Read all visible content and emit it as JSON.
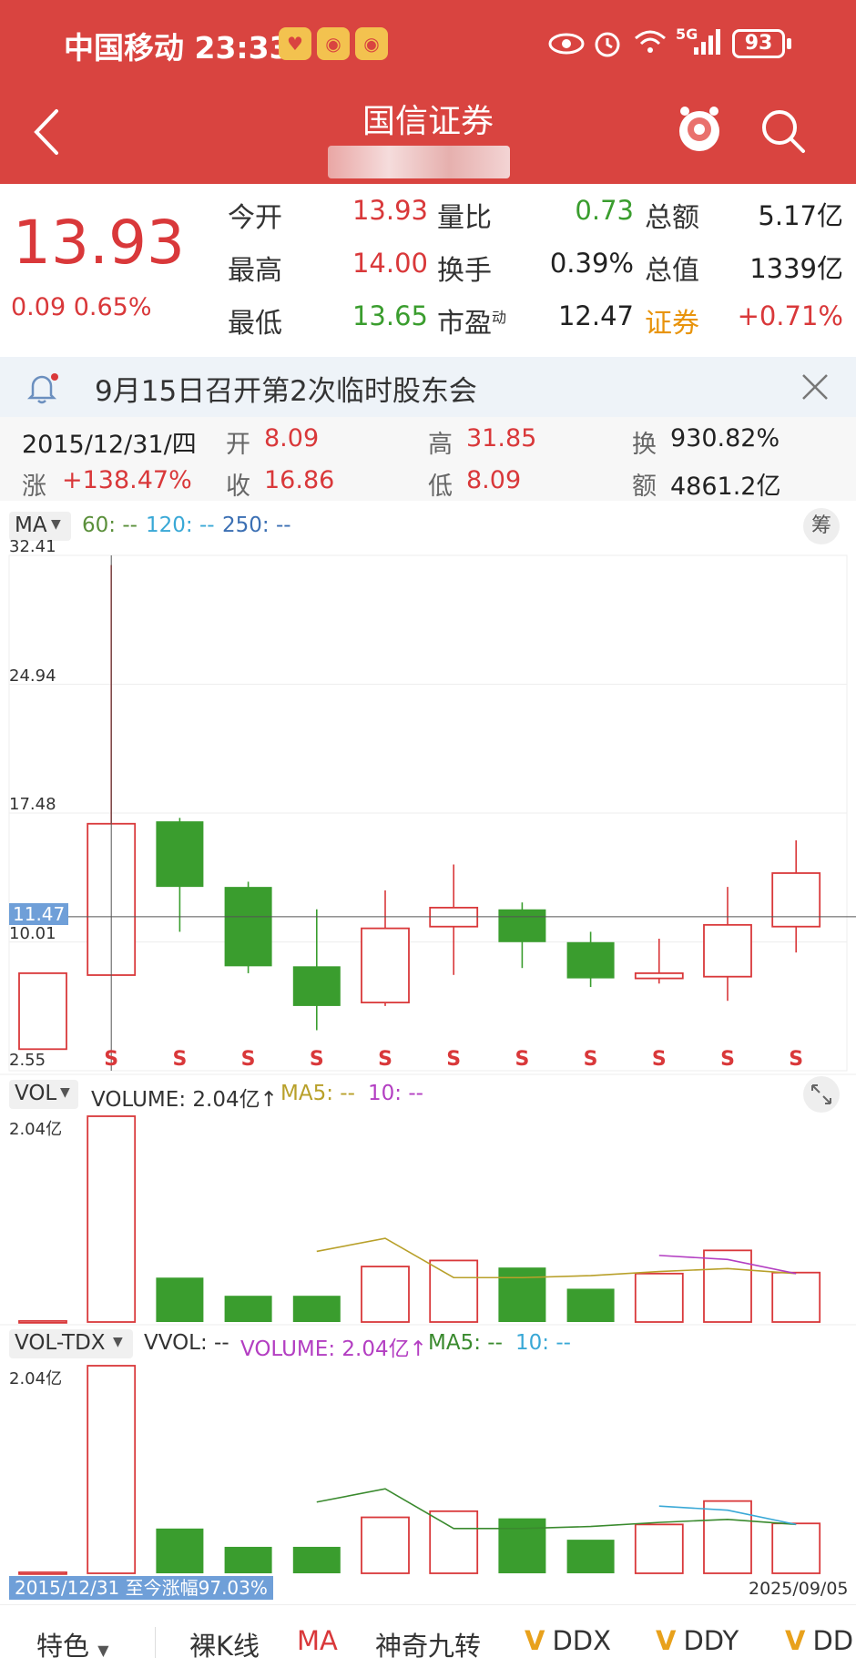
{
  "status_bar": {
    "carrier_time": "中国移动 23:33",
    "network": "5G",
    "battery": "93"
  },
  "nav": {
    "title": "国信证券",
    "icons": [
      "back-icon",
      "mascot-icon",
      "search-icon"
    ]
  },
  "quote": {
    "price": "13.93",
    "change": "0.09  0.65%",
    "rows": [
      {
        "l1": "今开",
        "v1": "13.93",
        "c1": "red",
        "l2": "量比",
        "v2": "0.73",
        "c2": "green",
        "l3": "总额",
        "v3": "5.17亿",
        "c3": "dark"
      },
      {
        "l1": "最高",
        "v1": "14.00",
        "c1": "red",
        "l2": "换手",
        "v2": "0.39%",
        "c2": "dark",
        "l3": "总值",
        "v3": "1339亿",
        "c3": "dark"
      },
      {
        "l1": "最低",
        "v1": "13.65",
        "c1": "green",
        "l2": "市盈",
        "l2sup": "动",
        "v2": "12.47",
        "c2": "dark",
        "l3": "证券",
        "v3": "+0.71%",
        "c3": "red"
      }
    ]
  },
  "notice": {
    "text": "9月15日召开第2次临时股东会"
  },
  "kline_info": {
    "date": "2015/12/31/四",
    "open_label": "开",
    "open": "8.09",
    "high_label": "高",
    "high": "31.85",
    "turn_label": "换",
    "turn": "930.82%",
    "chg_label": "涨",
    "chg": "+138.47%",
    "close_label": "收",
    "close": "16.86",
    "low_label": "低",
    "low": "8.09",
    "amt_label": "额",
    "amt": "4861.2亿"
  },
  "panels": {
    "ma_selector": "MA",
    "ma_values": [
      "60: --",
      "120: --",
      "250: --"
    ],
    "chip_button": "筹",
    "vol_selector": "VOL",
    "vol_text": "VOLUME: 2.04亿↑",
    "vol_ma5": "MA5: --",
    "vol_ma10": "10: --",
    "voltdx_selector": "VOL-TDX",
    "voltdx_vvol": "VVOL: --",
    "voltdx_volume": "VOLUME: 2.04亿↑",
    "voltdx_ma5": "MA5: --",
    "voltdx_ma10": "10: --",
    "crosshair_price": "11.47",
    "range_text": "2015/12/31 至今涨幅97.03%",
    "end_date": "2025/09/05"
  },
  "chart_data": {
    "type": "candlestick",
    "period": "yearly",
    "y_axis": {
      "min": 2.55,
      "max": 32.41,
      "ticks": [
        "32.41",
        "24.94",
        "17.48",
        "10.01",
        "2.55"
      ]
    },
    "candles": [
      {
        "open": 3.8,
        "close": 8.2,
        "high": 8.2,
        "low": 3.8,
        "up": true
      },
      {
        "open": 8.09,
        "close": 16.86,
        "high": 31.85,
        "low": 8.09,
        "up": true
      },
      {
        "open": 17.0,
        "close": 13.2,
        "high": 17.2,
        "low": 10.6,
        "up": false
      },
      {
        "open": 13.2,
        "close": 8.6,
        "high": 13.5,
        "low": 8.2,
        "up": false
      },
      {
        "open": 8.6,
        "close": 6.3,
        "high": 11.9,
        "low": 4.9,
        "up": false
      },
      {
        "open": 6.5,
        "close": 10.8,
        "high": 13.0,
        "low": 6.3,
        "up": true
      },
      {
        "open": 10.9,
        "close": 12.0,
        "high": 14.5,
        "low": 8.1,
        "up": true
      },
      {
        "open": 11.9,
        "close": 10.0,
        "high": 12.3,
        "low": 8.5,
        "up": false
      },
      {
        "open": 10.0,
        "close": 7.9,
        "high": 10.6,
        "low": 7.4,
        "up": false
      },
      {
        "open": 7.9,
        "close": 8.2,
        "high": 10.2,
        "low": 7.6,
        "up": true
      },
      {
        "open": 8.0,
        "close": 11.0,
        "high": 13.2,
        "low": 6.6,
        "up": true
      },
      {
        "open": 10.9,
        "close": 14.0,
        "high": 15.9,
        "low": 9.4,
        "up": true
      }
    ],
    "signal_marks": [
      "S",
      "S",
      "S",
      "S",
      "S",
      "S",
      "S",
      "S",
      "S",
      "S",
      "S"
    ],
    "volume": {
      "max_label": "2.04亿",
      "values": [
        0.01,
        2.04,
        0.44,
        0.26,
        0.26,
        0.55,
        0.61,
        0.54,
        0.33,
        0.48,
        0.71,
        0.49
      ],
      "ma5": [
        null,
        null,
        null,
        null,
        0.7,
        0.83,
        0.44,
        0.44,
        0.46,
        0.5,
        0.53,
        0.48
      ],
      "ma10": [
        null,
        null,
        null,
        null,
        null,
        null,
        null,
        null,
        null,
        0.66,
        0.62,
        0.48
      ]
    }
  },
  "tabs": [
    "特色",
    "裸K线",
    "MA",
    "神奇九转",
    "DDX",
    "DDY",
    "DD"
  ]
}
